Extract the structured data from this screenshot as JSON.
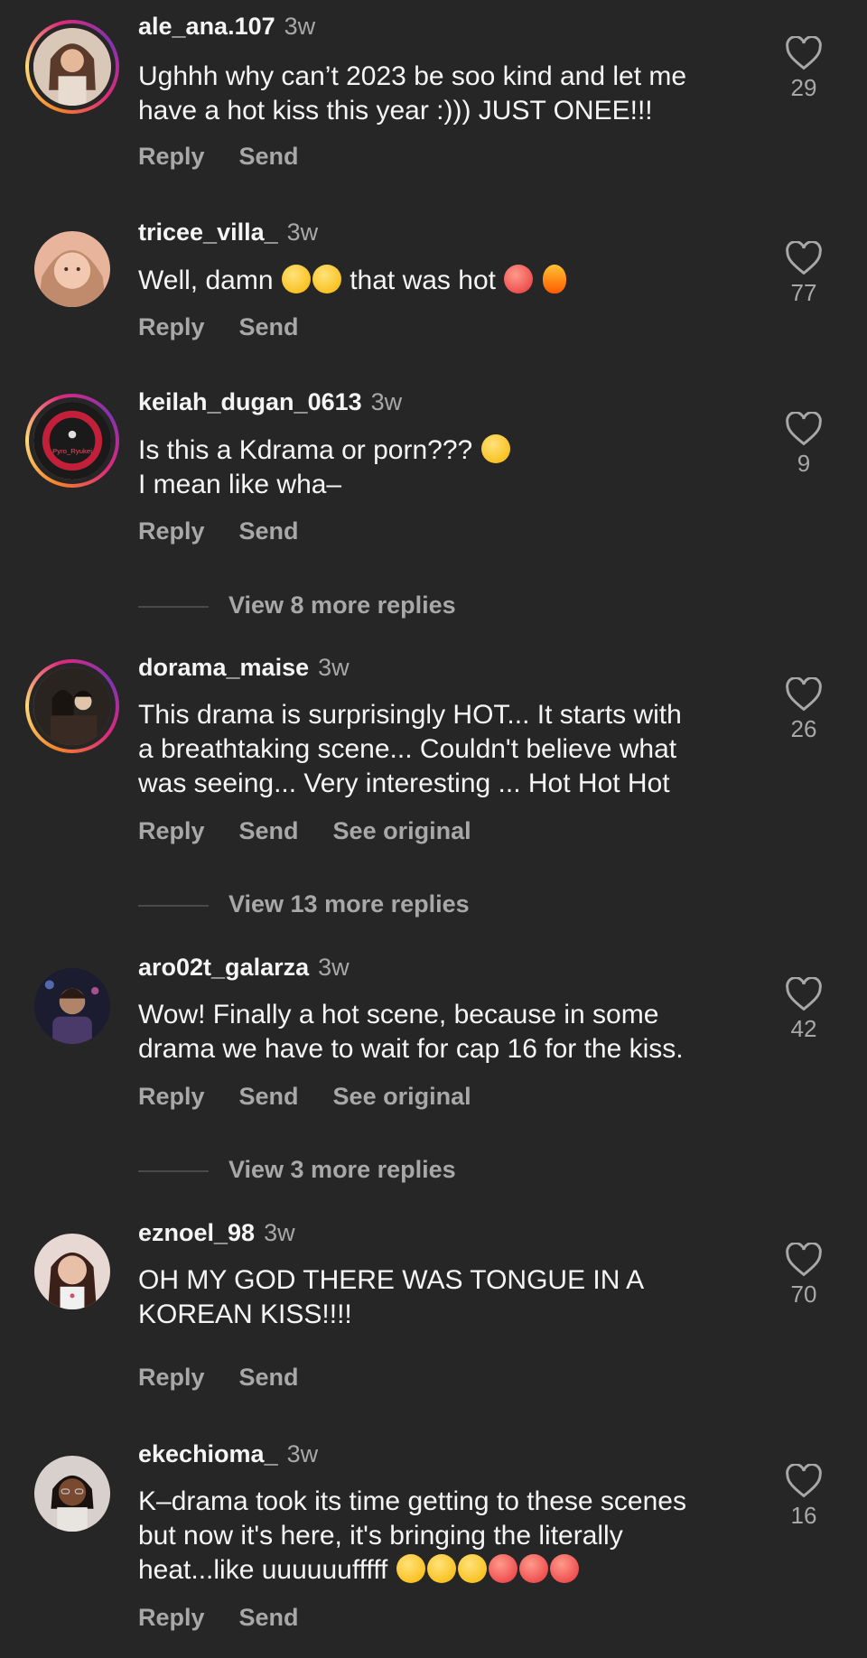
{
  "labels": {
    "reply": "Reply",
    "send": "Send",
    "see_original": "See original"
  },
  "comments": [
    {
      "username": "ale_ana.107",
      "time": "3w",
      "text": "Ughhh why can’t 2023 be soo kind and let me\nhave a hot kiss this year :))) JUST ONEE!!!",
      "likes": "29"
    },
    {
      "username": "tricee_villa_",
      "time": "3w",
      "text": "Well, damn",
      "text2": "that was hot",
      "likes": "77"
    },
    {
      "username": "keilah_dugan_0613",
      "time": "3w",
      "text": "Is this a Kdrama or porn???",
      "text2": "I mean like wha–",
      "likes": "9",
      "avatar_text": "Pyro_Ryukei"
    },
    {
      "username": "dorama_maise",
      "time": "3w",
      "text": "This drama is surprisingly HOT... It starts with\na breathtaking scene... Couldn't believe what\nwas seeing... Very interesting ... Hot Hot Hot",
      "likes": "26"
    },
    {
      "username": "aro02t_galarza",
      "time": "3w",
      "text": "Wow! Finally a hot scene, because in some\ndrama we have to wait for cap 16 for the kiss.",
      "likes": "42"
    },
    {
      "username": "eznoel_98",
      "time": "3w",
      "text": "OH MY GOD THERE WAS TONGUE IN A\nKOREAN KISS!!!!",
      "likes": "70"
    },
    {
      "username": "ekechioma_",
      "time": "3w",
      "text": "K–drama took its time getting to these scenes\nbut now it's here, it's bringing the literally",
      "text2": "heat...like uuuuuufffff",
      "likes": "16"
    }
  ],
  "view_more": [
    "View 8 more replies",
    "View 13 more replies",
    "View 3 more replies"
  ],
  "colors": {
    "background": "#262626",
    "secondary_text": "#a8a8a8",
    "ring_start": "#f58529",
    "ring_end": "#dd2a7b"
  }
}
